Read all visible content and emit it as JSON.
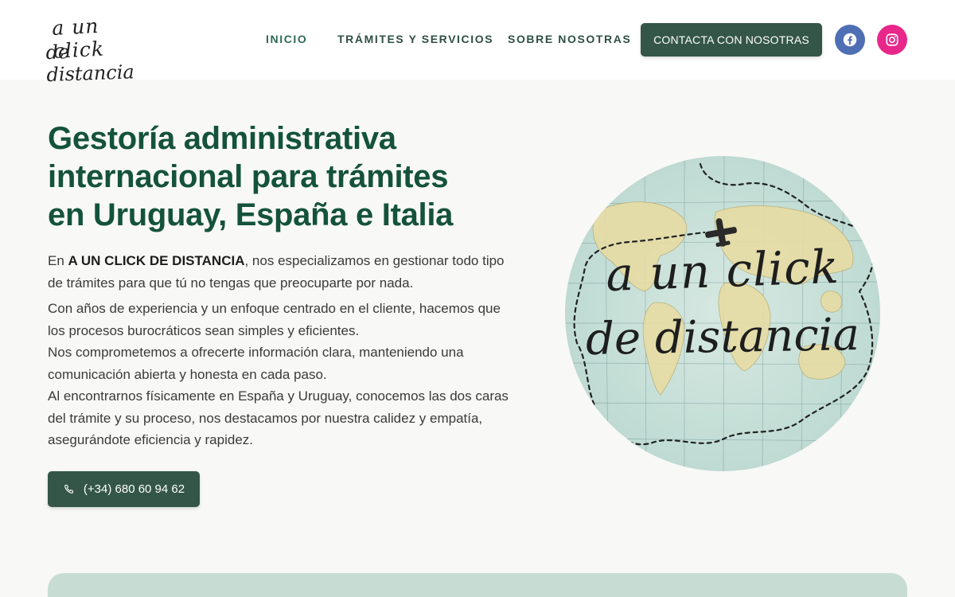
{
  "header": {
    "logo_line1": "a un click",
    "logo_line2": "de distancia",
    "nav": {
      "inicio": "INICIO",
      "tramites": "TRÁMITES Y SERVICIOS",
      "sobre": "SOBRE NOSOTRAS"
    },
    "cta_label": "CONTACTA CON NOSOTRAS",
    "social": [
      "facebook-icon",
      "instagram-icon"
    ]
  },
  "hero": {
    "title_lines": [
      "Gestoría administrativa",
      "internacional para trámites",
      "en Uruguay, España e Italia"
    ],
    "p1_prefix": "En ",
    "p1_bold": "A UN CLICK DE DISTANCIA",
    "p1_rest": ", nos especializamos en gestionar todo tipo de trámites para que tú no tengas que preocuparte por nada.",
    "p2_lines": [
      "Con años de experiencia y un enfoque centrado en el cliente, hacemos que los procesos burocráticos sean simples y eficientes.",
      "Nos comprometemos a ofrecerte información clara, manteniendo una comunicación abierta y honesta en cada paso.",
      "Al encontrarnos físicamente en España y Uruguay, conocemos las dos caras del trámite y su proceso, nos destacamos por nuestra calidez y empatía, asegurándote eficiencia y rapidez."
    ],
    "phone_label": "(+34) 680 60 94 62",
    "image_text_line1": "a un click",
    "image_text_line2": "de distancia"
  },
  "colors": {
    "brand_green": "#14523c",
    "button_green": "#345649",
    "facebook": "#4f6fb5",
    "instagram": "#e8278a",
    "band": "#c7ddd4"
  }
}
